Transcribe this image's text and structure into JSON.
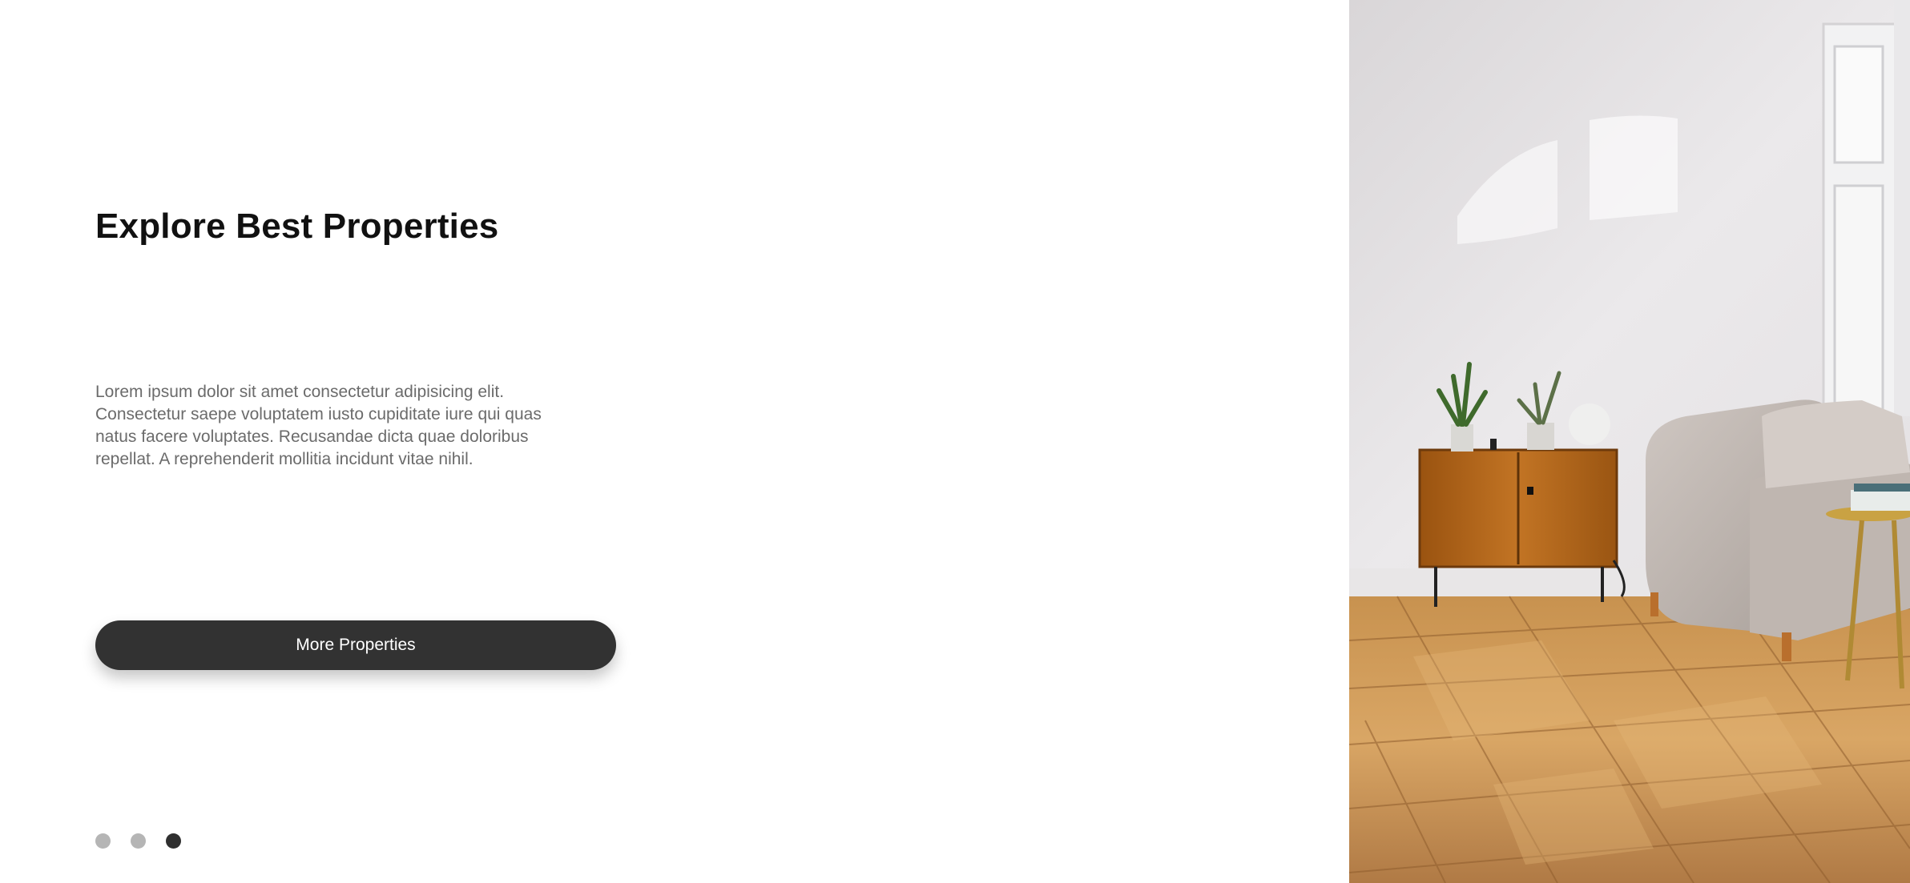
{
  "hero": {
    "title": "Explore Best Properties",
    "description": "Lorem ipsum dolor sit amet consectetur adipisicing elit. Consectetur saepe voluptatem iusto cupiditate iure qui quas natus facere voluptates. Recusandae dicta quae doloribus repellat. A reprehenderit mollitia incidunt vitae nihil.",
    "button_label": "More Properties"
  },
  "carousel": {
    "slide_count": 3,
    "active_index": 2
  },
  "colors": {
    "button_bg": "#323232",
    "dot_inactive": "#b5b5b5",
    "dot_active": "#2f2f2f"
  }
}
